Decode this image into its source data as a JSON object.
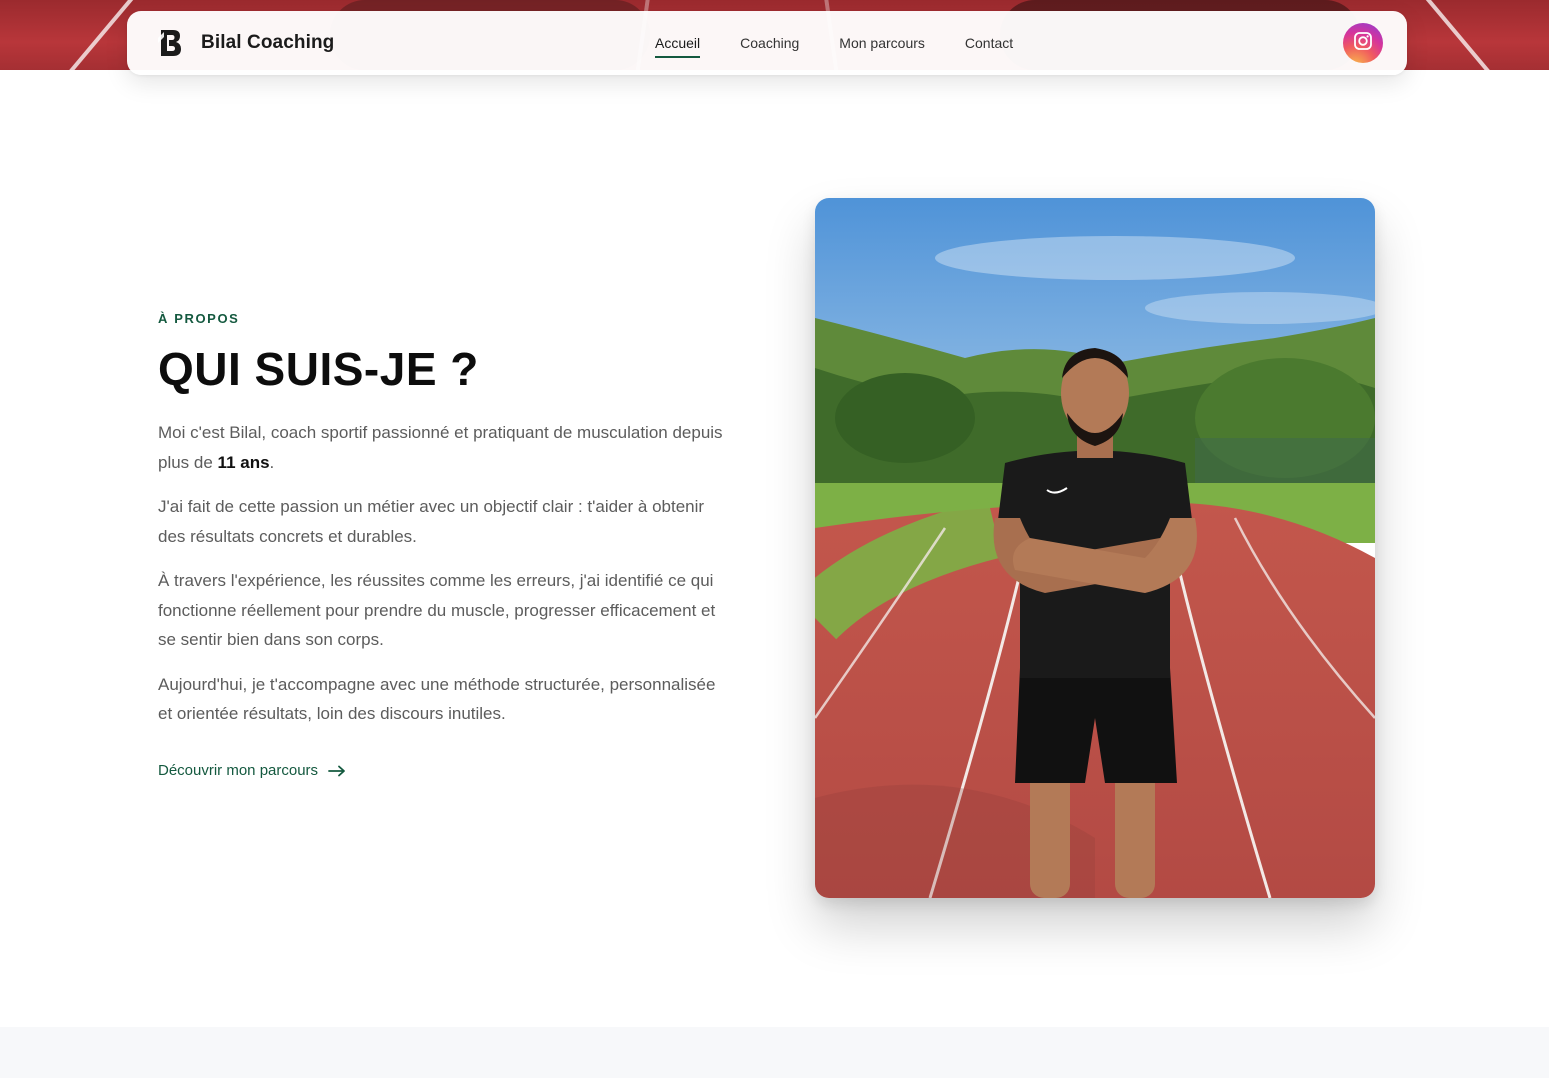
{
  "brand": {
    "name": "Bilal Coaching",
    "logo_icon": "b-monogram-icon"
  },
  "nav": {
    "items": [
      {
        "label": "Accueil",
        "active": true
      },
      {
        "label": "Coaching",
        "active": false
      },
      {
        "label": "Mon parcours",
        "active": false
      },
      {
        "label": "Contact",
        "active": false
      }
    ],
    "social_icon": "instagram-icon"
  },
  "about": {
    "eyebrow": "À PROPOS",
    "title": "QUI SUIS-JE ?",
    "p1_before": "Moi c'est Bilal, coach sportif passionné et pratiquant de musculation depuis plus de ",
    "p1_strong": "11 ans",
    "p1_after": ".",
    "p2": "J'ai fait de cette passion un métier avec un objectif clair : t'aider à obtenir des résultats concrets et durables.",
    "p3": "À travers l'expérience, les réussites comme les erreurs, j'ai identifié ce qui fonctionne réellement pour prendre du muscle, progresser efficacement et se sentir bien dans son corps.",
    "p4": "Aujourd'hui, je t'accompagne avec une méthode structurée, personnalisée et orientée résultats, loin des discours inutiles.",
    "cta_label": "Découvrir mon parcours",
    "cta_icon": "arrow-right-icon"
  },
  "colors": {
    "accent": "#14593f",
    "hero_red": "#b8363a",
    "section_bg": "#f7f8fa"
  }
}
